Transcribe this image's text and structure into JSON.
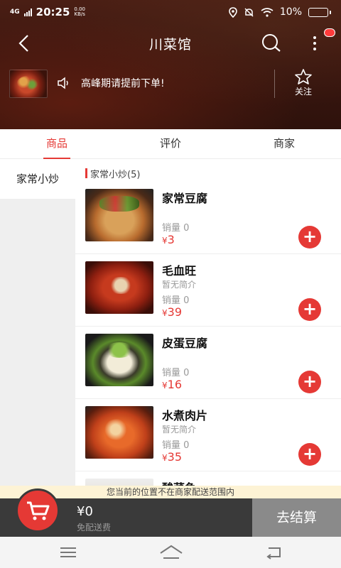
{
  "status_bar": {
    "network": "4G",
    "time": "20:25",
    "speed_value": "0.00",
    "speed_unit": "KB/s",
    "battery": "10%",
    "battery_level": 0.1
  },
  "header": {
    "title": "川菜馆",
    "notice": "高峰期请提前下单!",
    "follow_label": "关注"
  },
  "tabs": [
    {
      "label": "商品",
      "active": true
    },
    {
      "label": "评价",
      "active": false
    },
    {
      "label": "商家",
      "active": false
    }
  ],
  "sidebar": {
    "items": [
      {
        "label": "家常小炒",
        "active": true
      }
    ]
  },
  "category": {
    "title": "家常小炒(5)"
  },
  "items": [
    {
      "name": "家常豆腐",
      "desc": "",
      "sales": "销量 0",
      "currency": "¥",
      "price": "3"
    },
    {
      "name": "毛血旺",
      "desc": "暂无简介",
      "sales": "销量 0",
      "currency": "¥",
      "price": "39"
    },
    {
      "name": "皮蛋豆腐",
      "desc": "",
      "sales": "销量 0",
      "currency": "¥",
      "price": "16"
    },
    {
      "name": "水煮肉片",
      "desc": "暂无简介",
      "sales": "销量 0",
      "currency": "¥",
      "price": "35"
    },
    {
      "name": "酸菜鱼",
      "desc": "",
      "sales": "",
      "currency": "",
      "price": ""
    }
  ],
  "range_notice": "您当前的位置不在商家配送范围内",
  "cart": {
    "total": "¥0",
    "delivery": "免配送费",
    "checkout_label": "去结算"
  },
  "colors": {
    "accent": "#e53935",
    "cart_bar": "#3a3a3a",
    "checkout": "#8a8a8a",
    "banner": "#fdf3d5"
  },
  "icons": [
    "back-icon",
    "search-icon",
    "more-icon",
    "speaker-icon",
    "star-icon",
    "cart-icon",
    "menu-icon",
    "home-icon",
    "return-icon"
  ]
}
